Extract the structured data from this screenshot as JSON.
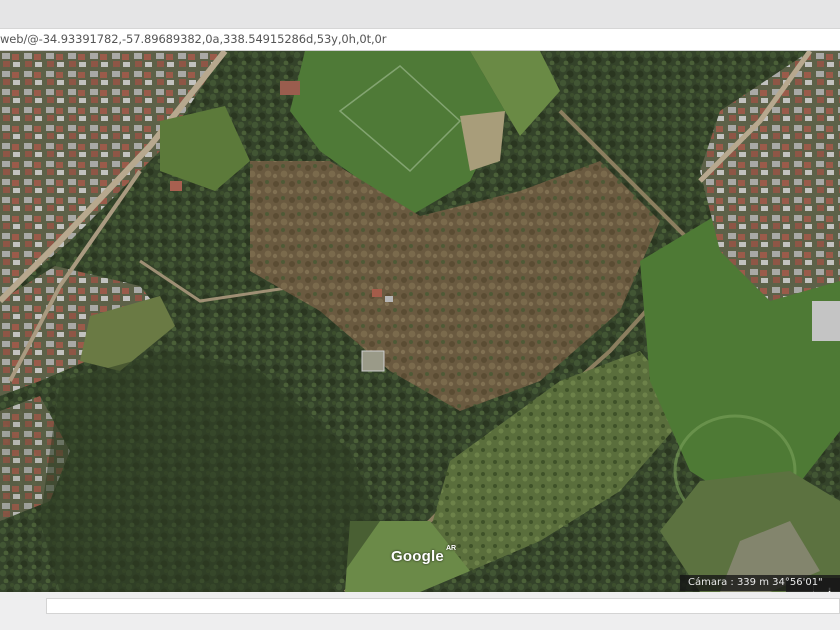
{
  "browser": {
    "address": "web/@-34.93391782,-57.89689382,0a,338.54915286d,53y,0h,0t,0r"
  },
  "map": {
    "imagery": "satellite",
    "attribution_logo": "Google",
    "attribution_superscript": "AR",
    "zoom_out_label": "−",
    "zoom_in_label": "+",
    "camera_readout": "Cámara : 339 m  34°56'01\""
  },
  "colors": {
    "field_green": "#4f7a37",
    "dense_tree": "#2f3d22",
    "dry_brush": "#6b5a3c",
    "road": "#b9a98d",
    "roof_red": "#9c5a48",
    "roof_gray": "#b7b7b7"
  }
}
